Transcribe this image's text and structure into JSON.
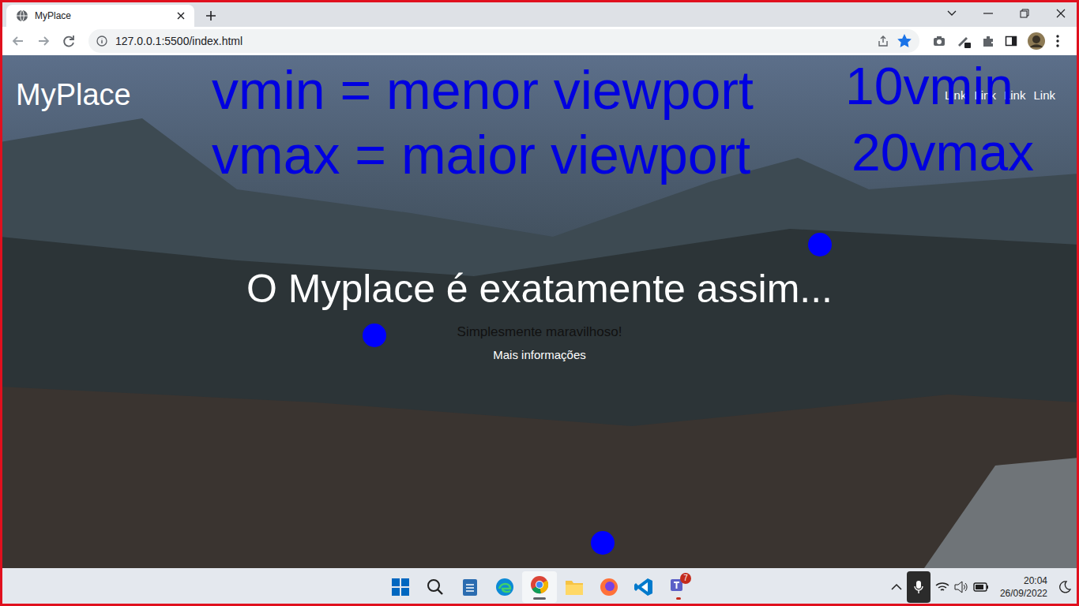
{
  "window": {
    "title": "MyPlace"
  },
  "tabs": [
    {
      "label": "MyPlace",
      "selected": true
    }
  ],
  "address_bar": {
    "url": "127.0.0.1:5500/index.html",
    "bookmarked": true
  },
  "page": {
    "logo": "MyPlace",
    "nav": [
      "Link",
      "Link",
      "Link",
      "Link"
    ],
    "hero": {
      "title": "O Myplace é exatamente assim...",
      "subtitle": "Simplesmente maravilhoso!",
      "link": "Mais informações"
    }
  },
  "annotations": {
    "left": [
      "vmin = menor viewport",
      "vmax = maior viewport"
    ],
    "right": [
      "10vmin",
      "20vmax"
    ]
  },
  "taskbar": {
    "teams_badge": "7",
    "time": "20:04",
    "date": "26/09/2022"
  }
}
